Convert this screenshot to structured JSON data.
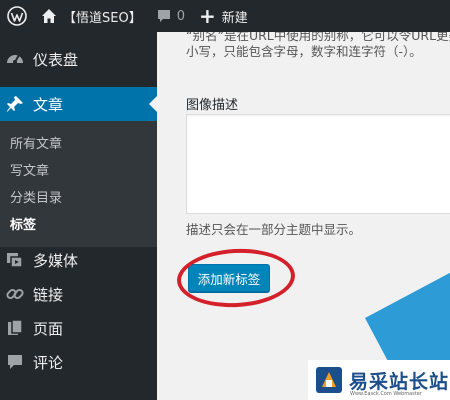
{
  "admin_bar": {
    "site_name": "【悟道SEO】",
    "comments_count": "0",
    "new_label": "新建"
  },
  "sidebar": {
    "dashboard": "仪表盘",
    "posts": "文章",
    "posts_submenu": [
      "所有文章",
      "写文章",
      "分类目录",
      "标签"
    ],
    "media": "多媒体",
    "links": "链接",
    "pages": "页面",
    "comments": "评论"
  },
  "form": {
    "slug_description_line1": "“别名”是在URL中使用的别称，它可以令URL更美观。通常使用",
    "slug_description_line2": "小写，只能包含字母，数字和连字符（-）。",
    "description_label": "图像描述",
    "description_value": "",
    "description_help": "描述只会在一部分主题中显示。",
    "submit_label": "添加新标签"
  },
  "watermark": {
    "title": "易采站长站",
    "subtitle": "Www.Easck.Com  Webmaster"
  },
  "colors": {
    "admin_dark": "#23282d",
    "accent_blue": "#0073aa",
    "button_blue": "#0085ba",
    "highlight_red": "#d4202a"
  }
}
